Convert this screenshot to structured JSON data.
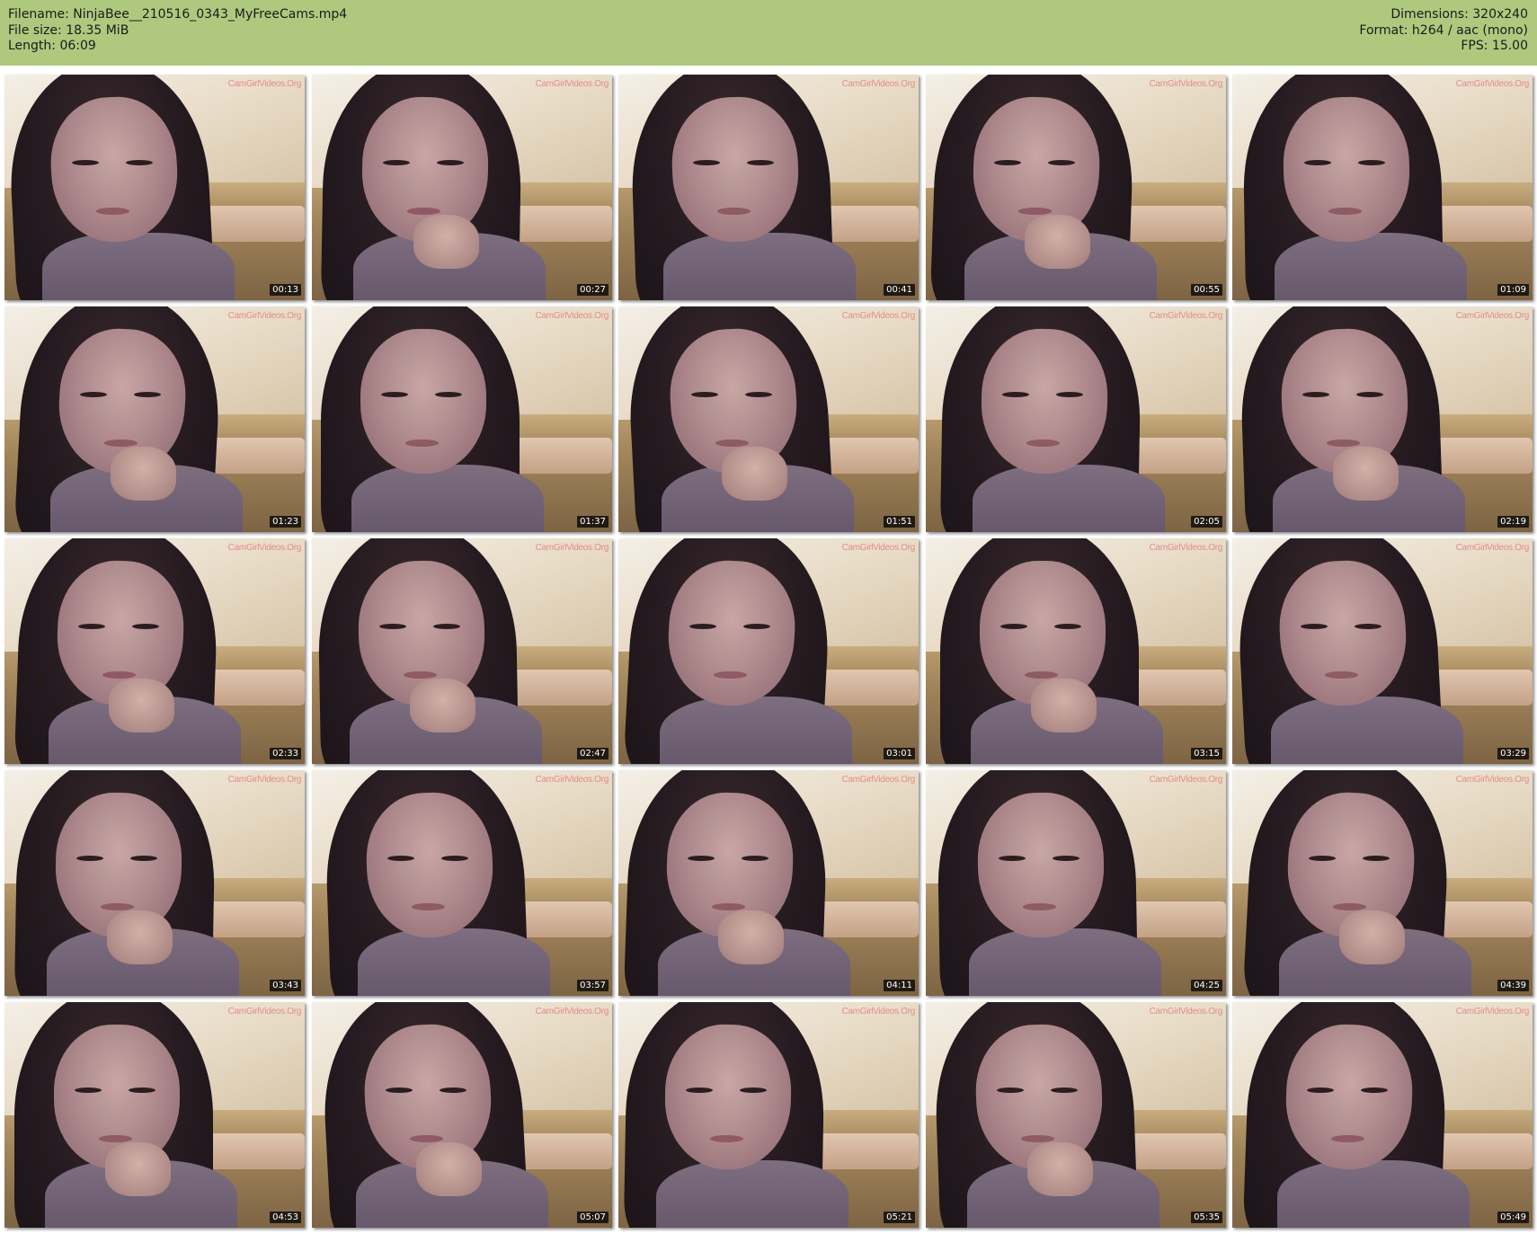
{
  "header": {
    "filename": "Filename: NinjaBee__210516_0343_MyFreeCams.mp4",
    "file_size": "File size: 18.35 MiB",
    "length": "Length: 06:09",
    "dimensions": "Dimensions: 320x240",
    "format": "Format: h264 / aac (mono)",
    "fps": "FPS: 15.00"
  },
  "colors": {
    "header_bg": "#aec97e",
    "page_bg": "#ffffff"
  },
  "thumbnails": {
    "watermark": "CamGirlVideos.Org",
    "timestamps": [
      "00:13",
      "00:27",
      "00:41",
      "00:55",
      "01:09",
      "01:23",
      "01:37",
      "01:51",
      "02:05",
      "02:19",
      "02:33",
      "02:47",
      "03:01",
      "03:15",
      "03:29",
      "03:43",
      "03:57",
      "04:11",
      "04:25",
      "04:39",
      "04:53",
      "05:07",
      "05:21",
      "05:35",
      "05:49"
    ]
  }
}
